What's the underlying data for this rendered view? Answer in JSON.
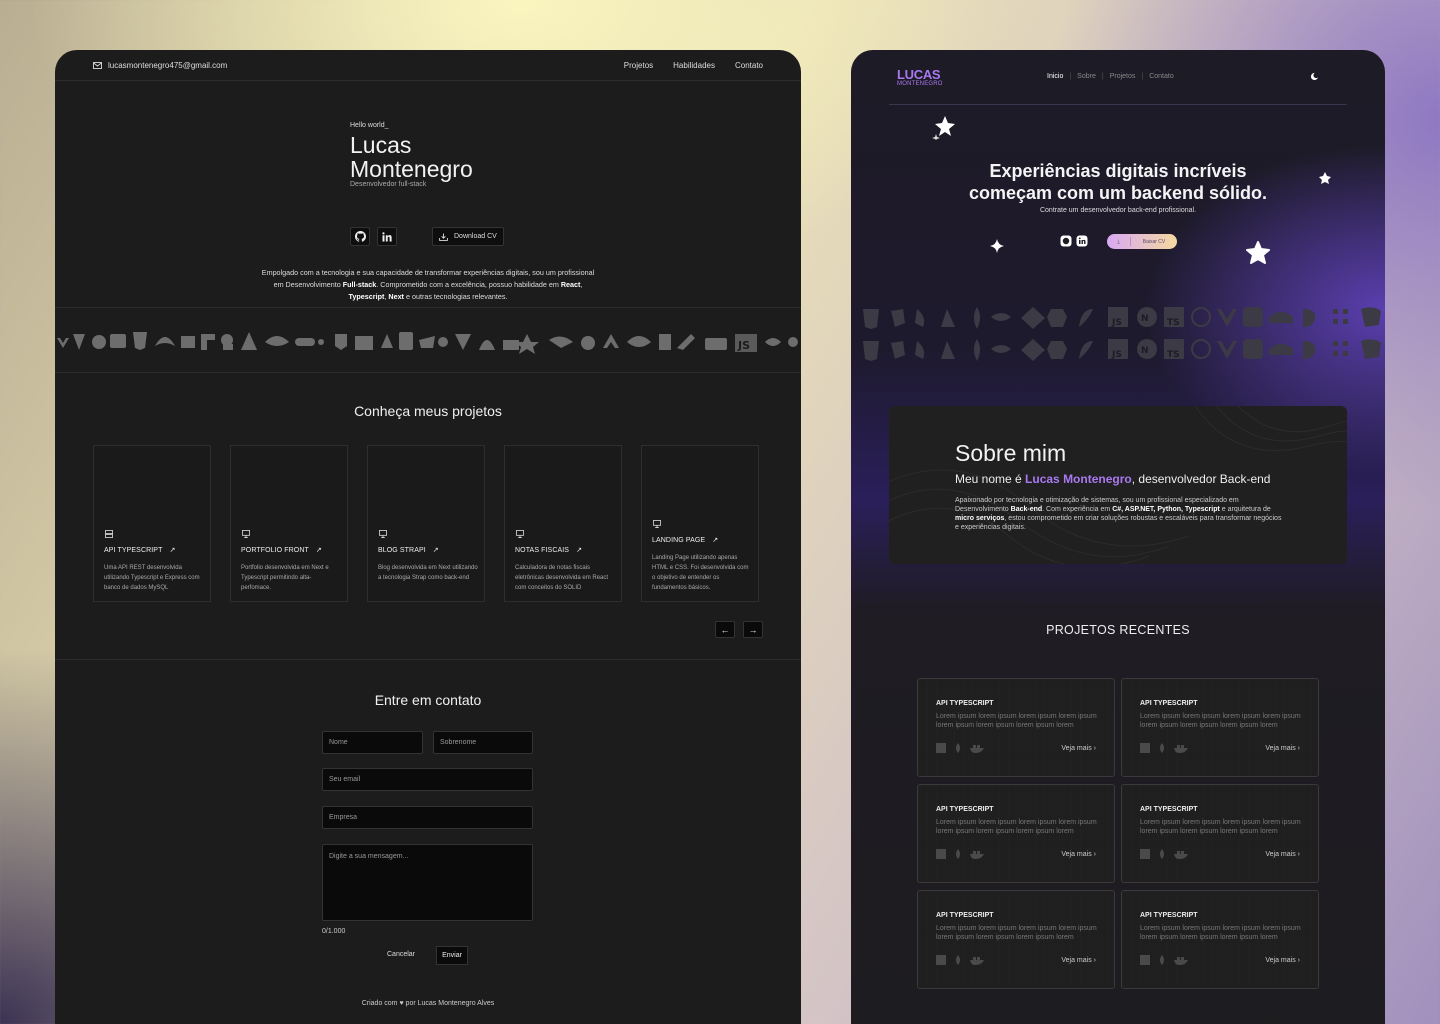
{
  "left": {
    "header": {
      "email": "lucasmontenegro475@gmail.com",
      "nav": [
        "Projetos",
        "Habilidades",
        "Contato"
      ]
    },
    "hero": {
      "greeting": "Hello world_",
      "name_line1": "Lucas",
      "name_line2": "Montenegro",
      "role": "Desenvolvedor full-stack",
      "download_label": "Download CV",
      "bio_1": "Empolgado com a tecnologia e sua capacidade de transformar experiências digitais, sou um profissional em Desenvolvimento ",
      "bio_b1": "Full-stack",
      "bio_2": ". Comprometido com a excelência, possuo habilidade em ",
      "bio_b2": "React",
      "bio_3": ", ",
      "bio_b3": "Typescript",
      "bio_4": ", ",
      "bio_b4": "Next",
      "bio_5": " e outras tecnologias relevantes."
    },
    "projects": {
      "title": "Conheça meus projetos",
      "cards": [
        {
          "title": "API TYPESCRIPT",
          "desc": "Uma API REST desenvolvida utilizando Typescript e Express com banco de dados MySQL",
          "icon": "server-icon"
        },
        {
          "title": "PORTFOLIO FRONT",
          "desc": "Portfolio desenvolvida em Next e Typescript permitindo alta-perfomace.",
          "icon": "monitor-icon"
        },
        {
          "title": "BLOG STRAPI",
          "desc": "Blog desenvolvida em Next utilizando a tecnologia Strap como back-end",
          "icon": "monitor-icon"
        },
        {
          "title": "NOTAS FISCAIS",
          "desc": "Calculadora de notas fiscais eletrônicas desenvolvida em React com conceitos do SOLID",
          "icon": "monitor-icon"
        },
        {
          "title": "LANDING PAGE",
          "desc": "Landing Page utilizando apenas HTML e CSS. Foi desenvolvida com o objetivo de entender os fundamentos básicos.",
          "icon": "monitor-icon"
        }
      ]
    },
    "contact": {
      "title": "Entre em contato",
      "first_name_ph": "Nome",
      "last_name_ph": "Sobrenome",
      "email_ph": "Seu email",
      "company_ph": "Empresa",
      "message_ph": "Digite a sua mensagem...",
      "counter": "0/1.000",
      "cancel": "Cancelar",
      "send": "Enviar"
    },
    "footer": "Criado com ♥ por Lucas Montenegro Alves"
  },
  "right": {
    "logo_main": "LUCAS",
    "logo_sub": "MONTENEGRO",
    "nav": [
      {
        "label": "Inicio",
        "active": true
      },
      {
        "label": "Sobre",
        "active": false
      },
      {
        "label": "Projetos",
        "active": false
      },
      {
        "label": "Contato",
        "active": false
      }
    ],
    "hero": {
      "title_1": "Experiências digitais incríveis",
      "title_2": "começam com um backend sólido.",
      "subtitle": "Contrate um desenvolvedor back-end profissional.",
      "cv_label": "Baixar CV"
    },
    "about": {
      "title": "Sobre mim",
      "intro_pre": "Meu nome é ",
      "intro_name": "Lucas Montenegro",
      "intro_post": ", desenvolvedor Back-end",
      "p1": "Apaixonado por tecnologia e otimização de sistemas, sou um profissional especializado em Desenvolvimento ",
      "p1b": "Back-end",
      "p2": ". Com experiência em ",
      "p2b": "C#, ASP.NET, Python, Typescript",
      "p3": " e arquitetura de ",
      "p3b": "micro serviços",
      "p4": ", estou comprometido em criar soluções robustas e escaláveis para transformar negócios e experiências digitais."
    },
    "recent": {
      "title": "PROJETOS RECENTES",
      "cards": [
        {
          "title": "API TYPESCRIPT",
          "desc": "Lorem ipsum lorem  ipsum lorem  ipsum lorem  ipsum lorem  ipsum lorem  ipsum lorem ipsum lorem",
          "more": "Veja mais"
        },
        {
          "title": "API TYPESCRIPT",
          "desc": "Lorem ipsum lorem  ipsum lorem  ipsum lorem  ipsum lorem  ipsum lorem  ipsum lorem ipsum lorem",
          "more": "Veja mais"
        },
        {
          "title": "API TYPESCRIPT",
          "desc": "Lorem ipsum lorem  ipsum lorem  ipsum lorem  ipsum lorem  ipsum lorem  ipsum lorem ipsum lorem",
          "more": "Veja mais"
        },
        {
          "title": "API TYPESCRIPT",
          "desc": "Lorem ipsum lorem  ipsum lorem  ipsum lorem  ipsum lorem  ipsum lorem  ipsum lorem ipsum lorem",
          "more": "Veja mais"
        },
        {
          "title": "API TYPESCRIPT",
          "desc": "Lorem ipsum lorem  ipsum lorem  ipsum lorem  ipsum lorem  ipsum lorem  ipsum lorem ipsum lorem",
          "more": "Veja mais"
        },
        {
          "title": "API TYPESCRIPT",
          "desc": "Lorem ipsum lorem  ipsum lorem  ipsum lorem  ipsum lorem  ipsum lorem  ipsum lorem ipsum lorem",
          "more": "Veja mais"
        }
      ]
    }
  },
  "colors": {
    "accent": "#a979f0",
    "left_bg": "#1c1c1c",
    "right_glow": "#5a3fb0"
  }
}
